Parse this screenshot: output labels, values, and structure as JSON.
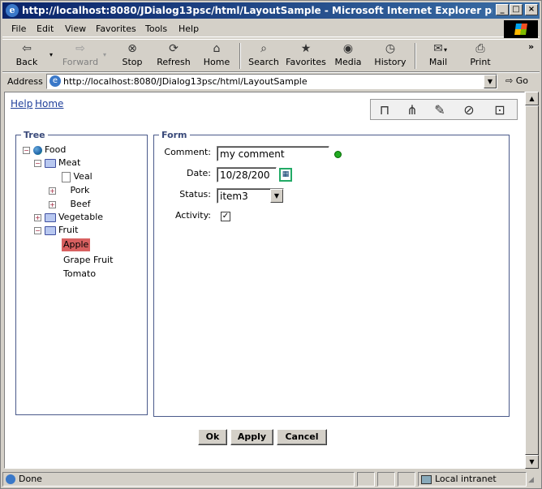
{
  "window": {
    "title": "http://localhost:8080/JDialog13psc/html/LayoutSample - Microsoft Internet Explorer provided by Da...",
    "minimize": "_",
    "maximize": "□",
    "close": "×"
  },
  "menubar": [
    "File",
    "Edit",
    "View",
    "Favorites",
    "Tools",
    "Help"
  ],
  "toolbar": {
    "back": "Back",
    "forward": "Forward",
    "stop": "Stop",
    "refresh": "Refresh",
    "home": "Home",
    "search": "Search",
    "favorites": "Favorites",
    "media": "Media",
    "history": "History",
    "mail": "Mail",
    "print": "Print",
    "more": "»"
  },
  "address": {
    "label": "Address",
    "url": "http://localhost:8080/JDialog13psc/html/LayoutSample",
    "go": "Go"
  },
  "page": {
    "links": [
      "Help",
      "Home"
    ],
    "tree": {
      "legend": "Tree",
      "nodes": {
        "food": "Food",
        "meat": "Meat",
        "veal": "Veal",
        "pork": "Pork",
        "beef": "Beef",
        "vegetable": "Vegetable",
        "fruit": "Fruit",
        "apple": "Apple",
        "grape": "Grape Fruit",
        "tomato": "Tomato"
      },
      "selected": "Apple"
    },
    "form": {
      "legend": "Form",
      "comment_label": "Comment:",
      "comment_value": "my comment",
      "date_label": "Date:",
      "date_value": "10/28/200",
      "status_label": "Status:",
      "status_value": "item3",
      "activity_label": "Activity:",
      "activity_checked": true
    },
    "buttons": {
      "ok": "Ok",
      "apply": "Apply",
      "cancel": "Cancel"
    }
  },
  "statusbar": {
    "text": "Done",
    "zone": "Local intranet"
  }
}
